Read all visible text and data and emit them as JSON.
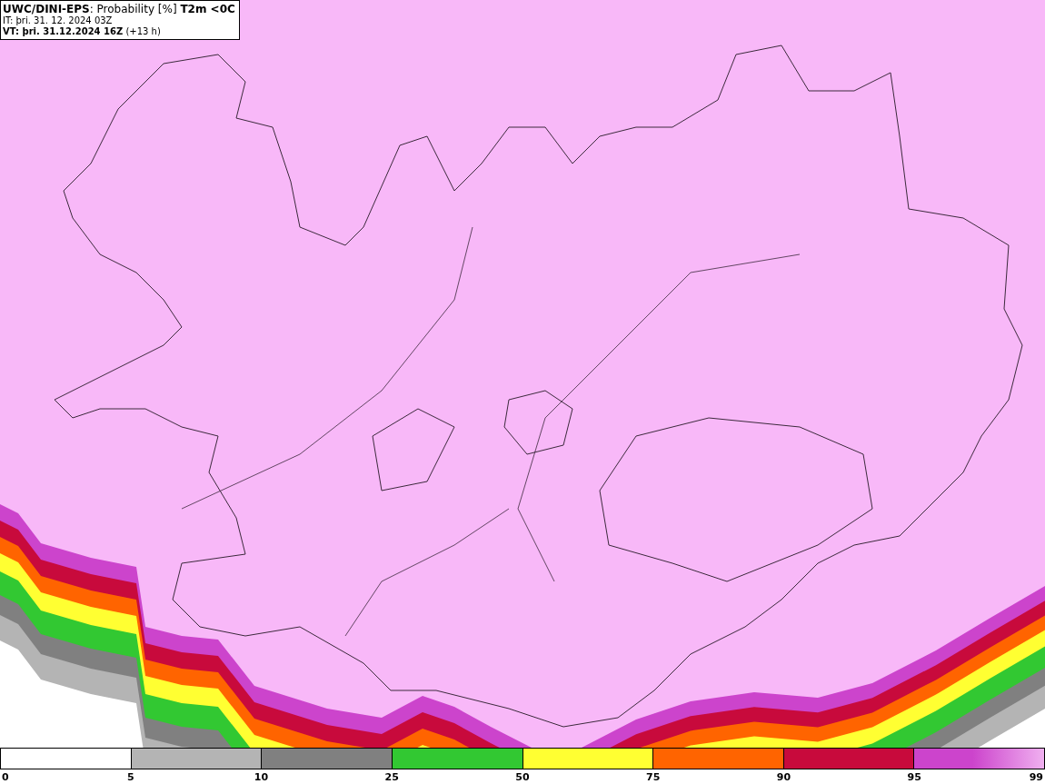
{
  "header": {
    "title": "**UWC/DINI-EPS**: Probability [%] **T2m <0C**",
    "init_time": "IT: þri. 31. 12. 2024 03Z",
    "valid_time": "**VT: þri. 31.12.2024 16Z** (+13 h)"
  },
  "legend": {
    "segments": [
      {
        "kind": "solid",
        "color": "#ffffff"
      },
      {
        "kind": "solid",
        "color": "#b4b4b4"
      },
      {
        "kind": "solid",
        "color": "#808080"
      },
      {
        "kind": "solid",
        "color": "#32c832"
      },
      {
        "kind": "solid",
        "color": "#ffff32"
      },
      {
        "kind": "solid",
        "color": "#ff6400"
      },
      {
        "kind": "solid",
        "color": "#c80a3c"
      },
      {
        "kind": "gradient",
        "color": "#cc44cc"
      }
    ],
    "ticks": [
      "0",
      "5",
      "10",
      "25",
      "50",
      "75",
      "90",
      "95",
      "99"
    ]
  }
}
